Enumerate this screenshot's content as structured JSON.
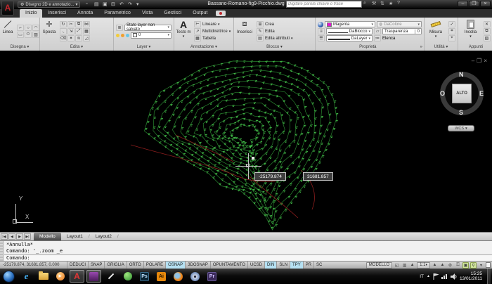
{
  "titlebar": {
    "workspace": "Disegno 2D e annotazio...",
    "title": "Bassano-Romano-fig9-Picchio.dwg",
    "search_placeholder": "Digitare parola chiave o frase"
  },
  "tabs": [
    "Inizio",
    "Inserisci",
    "Annota",
    "Parametrico",
    "Vista",
    "Gestisci",
    "Output"
  ],
  "ribbon": {
    "disegna": {
      "big": "Linea",
      "label": "Disegna"
    },
    "edita": {
      "big": "Sposta",
      "label": "Edita"
    },
    "layer": {
      "state": "Stato layer non salvato",
      "current": "0",
      "label": "Layer"
    },
    "annotazione": {
      "big": "Testo m",
      "item1": "Lineare",
      "item2": "Multidirettrice",
      "item3": "Tabella",
      "label": "Annotazione"
    },
    "blocco": {
      "big": "Inserisci",
      "item1": "Crea",
      "item2": "Edita",
      "item3": "Edita attributi",
      "label": "Blocco"
    },
    "proprieta": {
      "color": "Magenta",
      "dacolore": "DaColore",
      "dablocco": "DaBlocco",
      "dalayer": "DaLayer",
      "trasparenza": "Trasparenza",
      "trasparenza_val": "0",
      "elenca": "Elenca",
      "label": "Proprietà"
    },
    "utilita": {
      "big": "Misura",
      "label": "Utilità"
    },
    "appunti": {
      "big": "Incolla",
      "label": "Appunti"
    }
  },
  "canvas": {
    "viewcube": {
      "n": "N",
      "s": "S",
      "e": "E",
      "w": "O",
      "top": "ALTO",
      "wcs": "WCS"
    },
    "ucs": {
      "x": "X",
      "y": "Y"
    },
    "tooltip_x": "-25179.874",
    "tooltip_y": "31681.857",
    "colors": {
      "contour": "#2c9133",
      "marks": "#45c14b",
      "red": "#8b1d1d",
      "bg": "#000000"
    }
  },
  "commandline": {
    "history1": "*Annulla*",
    "history2": "Comando: '_.zoom _e",
    "prompt": "Comando:"
  },
  "modeltabs": {
    "modello": "Modello",
    "layout1": "Layout1",
    "layout2": "Layout2"
  },
  "statusbar": {
    "coords": "-25179.874, 31681.857, 0.000",
    "toggles": [
      "DEDUCI",
      "SNAP",
      "GRIGLIA",
      "ORTO",
      "POLARE",
      "OSNAP",
      "3DOSNAP",
      "OPUNTAMENTO",
      "UCSD",
      "DIN",
      "SLN",
      "TPY",
      "PR",
      "SC"
    ],
    "modello_btn": "MODELLO",
    "scale": "1:1"
  },
  "taskbar": {
    "ie_glyph": "e",
    "acad_glyph": "A",
    "ps_glyph": "Ps",
    "ai_glyph": "Ai",
    "pr_glyph": "Pr",
    "lang": "IT",
    "time": "15:25",
    "date": "13/01/2011"
  }
}
